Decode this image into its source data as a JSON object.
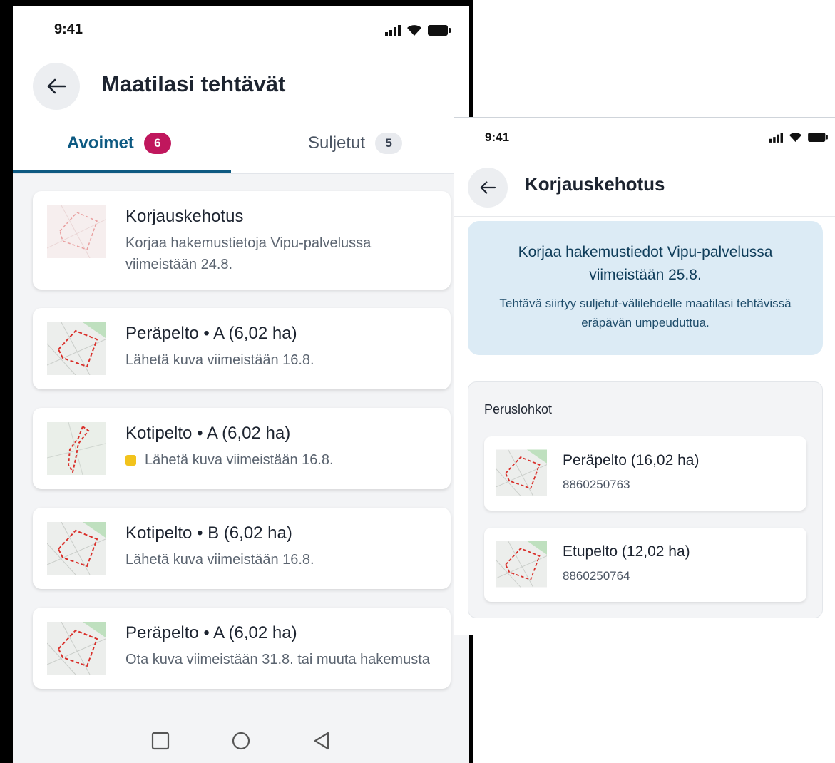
{
  "phone1": {
    "status_time": "9:41",
    "title": "Maatilasi tehtävät",
    "tabs": [
      {
        "label": "Avoimet",
        "count": "6",
        "active": true
      },
      {
        "label": "Suljetut",
        "count": "5",
        "active": false
      }
    ],
    "tasks": [
      {
        "title": "Korjauskehotus",
        "subtitle": "Korjaa hakemustietoja Vipu-palvelussa viimeistään 24.8.",
        "warning": false
      },
      {
        "title": "Peräpelto • A (6,02 ha)",
        "subtitle": "Lähetä kuva viimeistään 16.8.",
        "warning": false
      },
      {
        "title": "Kotipelto • A (6,02 ha)",
        "subtitle": "Lähetä kuva viimeistään 16.8.",
        "warning": true
      },
      {
        "title": "Kotipelto • B (6,02 ha)",
        "subtitle": "Lähetä kuva viimeistään 16.8.",
        "warning": false
      },
      {
        "title": "Peräpelto • A (6,02 ha)",
        "subtitle": "Ota kuva viimeistään 31.8. tai muuta hakemusta",
        "warning": false
      }
    ]
  },
  "phone2": {
    "status_time": "9:41",
    "title": "Korjauskehotus",
    "info_title": "Korjaa hakemustiedot Vipu-palvelussa viimeistään 25.8.",
    "info_text": "Tehtävä siirtyy suljetut-välilehdelle maatilasi tehtävissä eräpävän umpeuduttua.",
    "plots_label": "Peruslohkot",
    "plots": [
      {
        "name": "Peräpelto (16,02 ha)",
        "id": "8860250763"
      },
      {
        "name": "Etupelto (12,02 ha)",
        "id": "8860250764"
      }
    ]
  },
  "colors": {
    "accent": "#0e5a82",
    "badge": "#c0175d",
    "warning": "#f2c31c",
    "info_bg": "#dcebf5"
  },
  "icons": [
    "back-arrow-icon",
    "signal-icon",
    "wifi-icon",
    "battery-icon",
    "field-map-thumbnail",
    "nav-square-icon",
    "nav-circle-icon",
    "nav-back-triangle-icon"
  ]
}
